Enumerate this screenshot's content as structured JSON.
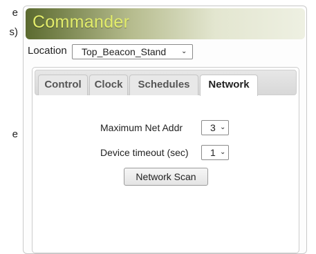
{
  "left_edge": {
    "line1": "e",
    "line2": "s)",
    "line3": "e"
  },
  "app": {
    "title": "Commander"
  },
  "location": {
    "label": "Location",
    "selected": "Top_Beacon_Stand"
  },
  "tabs": [
    {
      "label": "Control",
      "active": false
    },
    {
      "label": "Clock",
      "active": false
    },
    {
      "label": "Schedules",
      "active": false
    },
    {
      "label": "Network",
      "active": true
    }
  ],
  "network": {
    "max_net_addr": {
      "label": "Maximum Net Addr",
      "value": "3"
    },
    "device_timeout": {
      "label": "Device timeout (sec)",
      "value": "1"
    },
    "scan_button": "Network Scan"
  },
  "colors": {
    "banner_title": "#e3ed6b",
    "banner_dark": "#5b6a2f"
  },
  "icons": {
    "dropdown": "chevron-down-icon"
  }
}
